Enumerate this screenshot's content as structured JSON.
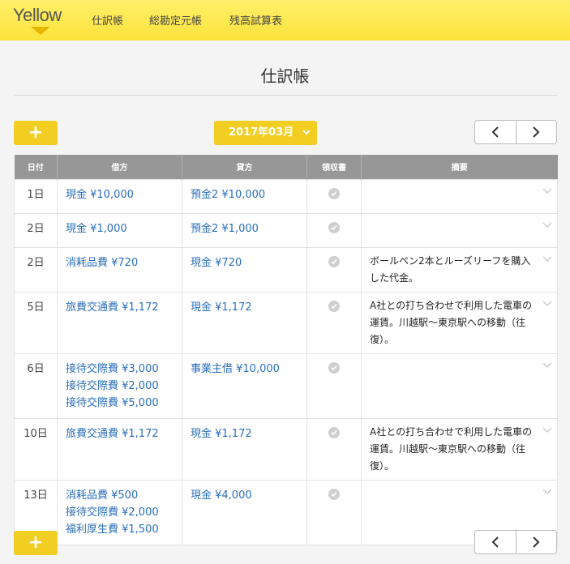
{
  "header": {
    "logo": "Yellow",
    "nav": [
      "仕訳帳",
      "総勘定元帳",
      "残高試算表"
    ]
  },
  "page": {
    "title": "仕訳帳"
  },
  "toolbar": {
    "add_label": "+",
    "month_label": "2017年03月"
  },
  "table": {
    "columns": [
      "日付",
      "借方",
      "貸方",
      "領収書",
      "摘要"
    ],
    "rows": [
      {
        "day": "1日",
        "debit": [
          "現金 ¥10,000"
        ],
        "credit": [
          "預金2 ¥10,000"
        ],
        "memo": ""
      },
      {
        "day": "2日",
        "debit": [
          "現金 ¥1,000"
        ],
        "credit": [
          "預金2 ¥1,000"
        ],
        "memo": ""
      },
      {
        "day": "2日",
        "debit": [
          "消耗品費 ¥720"
        ],
        "credit": [
          "現金 ¥720"
        ],
        "memo": "ボールペン2本とルーズリーフを購入した代金。"
      },
      {
        "day": "5日",
        "debit": [
          "旅費交通費 ¥1,172"
        ],
        "credit": [
          "現金 ¥1,172"
        ],
        "memo": "A社との打ち合わせで利用した電車の運賃。川越駅〜東京駅への移動（往復）。"
      },
      {
        "day": "6日",
        "debit": [
          "接待交際費 ¥3,000",
          "接待交際費 ¥2,000",
          "接待交際費 ¥5,000"
        ],
        "credit": [
          "事業主借 ¥10,000"
        ],
        "memo": ""
      },
      {
        "day": "10日",
        "debit": [
          "旅費交通費 ¥1,172"
        ],
        "credit": [
          "現金 ¥1,172"
        ],
        "memo": "A社との打ち合わせで利用した電車の運賃。川越駅〜東京駅への移動（往復）。"
      },
      {
        "day": "13日",
        "debit": [
          "消耗品費 ¥500",
          "接待交際費 ¥2,000",
          "福利厚生費 ¥1,500"
        ],
        "credit": [
          "現金 ¥4,000"
        ],
        "memo": ""
      }
    ]
  },
  "icons": {
    "receipt": "check-circle-icon",
    "expand": "chevron-down-icon",
    "prev": "chevron-left-icon",
    "next": "chevron-right-icon"
  },
  "colors": {
    "header": "#fde23a",
    "accent": "#f2ce23",
    "link": "#2a6ebb",
    "table_header": "#979797"
  }
}
